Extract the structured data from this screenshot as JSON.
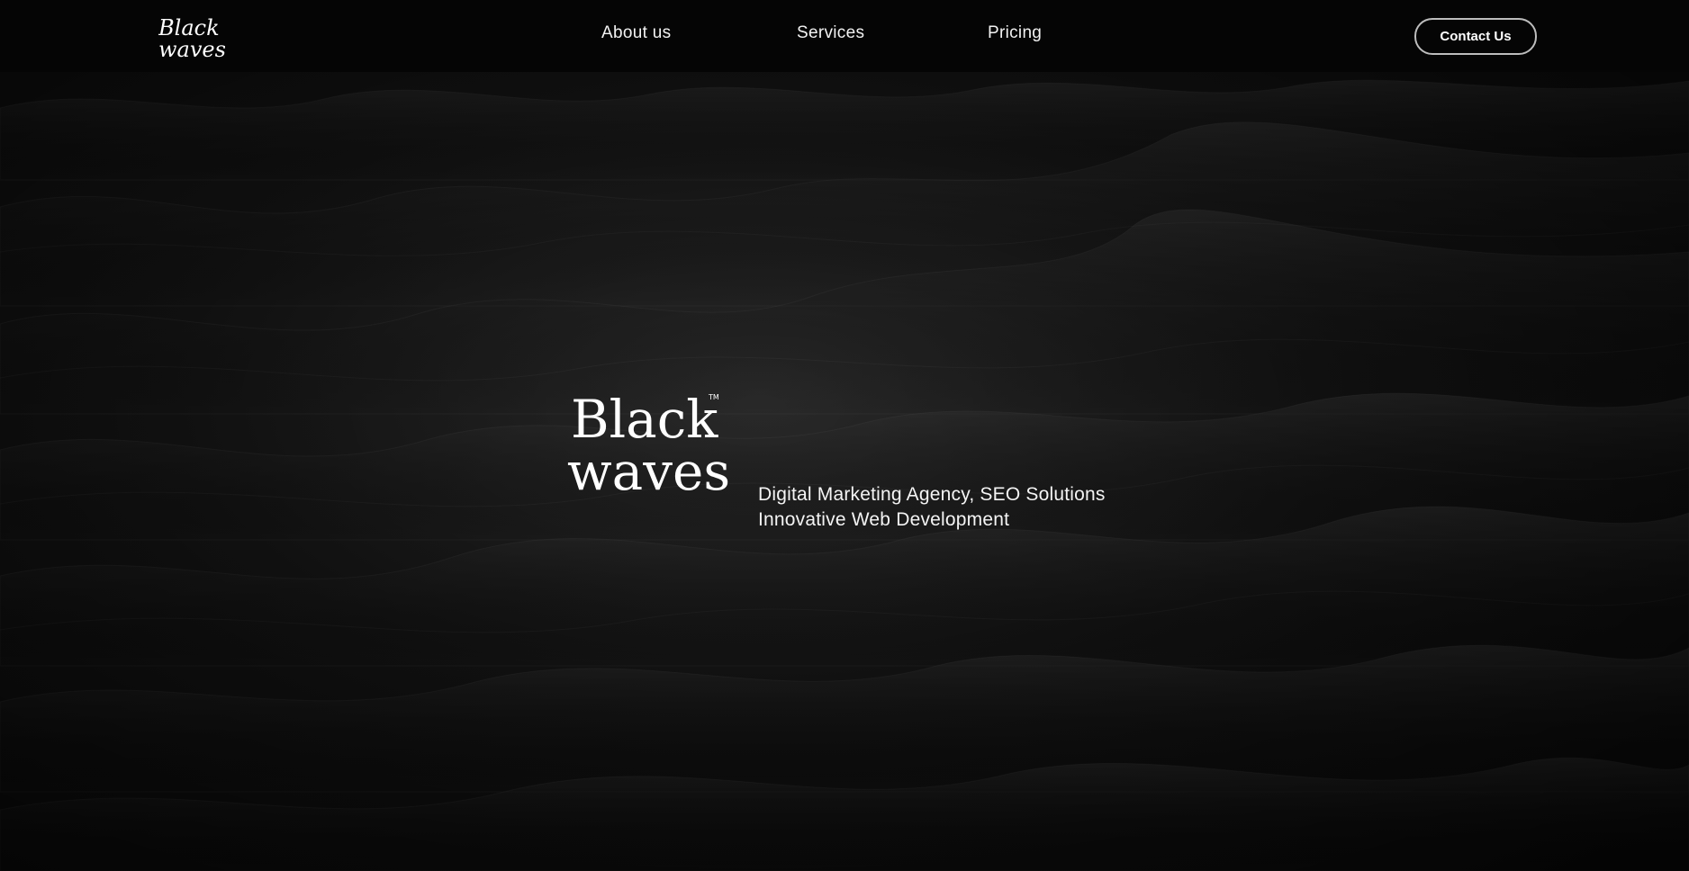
{
  "brand": {
    "name_line1": "Black",
    "name_line2": "waves",
    "trademark": "TM"
  },
  "nav": {
    "items": [
      {
        "label": "About us"
      },
      {
        "label": "Services"
      },
      {
        "label": "Pricing"
      }
    ],
    "contact_label": "Contact Us"
  },
  "hero": {
    "tagline_line1": "Digital Marketing Agency, SEO Solutions",
    "tagline_line2": "Innovative Web Development",
    "background": "dark-ocean-waves-image"
  },
  "colors": {
    "header_bg": "#050505",
    "text": "#f4f4f4",
    "button_border": "#bdbdbd"
  }
}
